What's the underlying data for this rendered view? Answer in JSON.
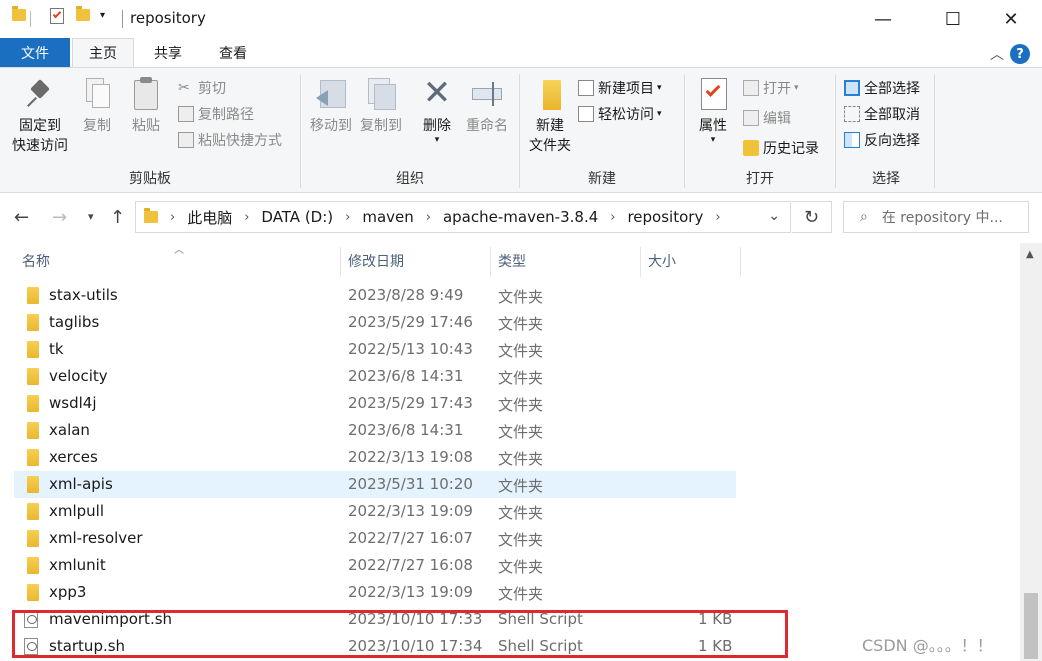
{
  "window": {
    "title": "repository",
    "minimize": "—",
    "maximize": "☐",
    "close": "✕"
  },
  "ribbon_tabs": {
    "file": "文件",
    "home": "主页",
    "share": "共享",
    "view": "查看"
  },
  "ribbon": {
    "clipboard": {
      "label": "剪贴板",
      "pin": [
        "固定到",
        "快速访问"
      ],
      "copy": "复制",
      "paste": "粘贴",
      "cut": "剪切",
      "copy_path": "复制路径",
      "paste_shortcut": "粘贴快捷方式"
    },
    "organize": {
      "label": "组织",
      "move_to": "移动到",
      "copy_to": "复制到",
      "delete": "删除",
      "rename": "重命名"
    },
    "new": {
      "label": "新建",
      "new_folder": [
        "新建",
        "文件夹"
      ],
      "new_item": "新建项目",
      "easy_access": "轻松访问"
    },
    "open": {
      "label": "打开",
      "properties": "属性",
      "open": "打开",
      "edit": "编辑",
      "history": "历史记录"
    },
    "select": {
      "label": "选择",
      "select_all": "全部选择",
      "select_none": "全部取消",
      "invert": "反向选择"
    }
  },
  "address": {
    "crumbs": [
      "此电脑",
      "DATA (D:)",
      "maven",
      "apache-maven-3.8.4",
      "repository"
    ],
    "search_placeholder": "在 repository 中..."
  },
  "columns": {
    "name": "名称",
    "modified": "修改日期",
    "type": "类型",
    "size": "大小"
  },
  "files": [
    {
      "name": "stax-utils",
      "date": "2023/8/28 9:49",
      "type": "文件夹",
      "size": "",
      "kind": "folder"
    },
    {
      "name": "taglibs",
      "date": "2023/5/29 17:46",
      "type": "文件夹",
      "size": "",
      "kind": "folder"
    },
    {
      "name": "tk",
      "date": "2022/5/13 10:43",
      "type": "文件夹",
      "size": "",
      "kind": "folder"
    },
    {
      "name": "velocity",
      "date": "2023/6/8 14:31",
      "type": "文件夹",
      "size": "",
      "kind": "folder"
    },
    {
      "name": "wsdl4j",
      "date": "2023/5/29 17:43",
      "type": "文件夹",
      "size": "",
      "kind": "folder"
    },
    {
      "name": "xalan",
      "date": "2023/6/8 14:31",
      "type": "文件夹",
      "size": "",
      "kind": "folder"
    },
    {
      "name": "xerces",
      "date": "2022/3/13 19:08",
      "type": "文件夹",
      "size": "",
      "kind": "folder"
    },
    {
      "name": "xml-apis",
      "date": "2023/5/31 10:20",
      "type": "文件夹",
      "size": "",
      "kind": "folder",
      "selected": true
    },
    {
      "name": "xmlpull",
      "date": "2022/3/13 19:09",
      "type": "文件夹",
      "size": "",
      "kind": "folder"
    },
    {
      "name": "xml-resolver",
      "date": "2022/7/27 16:07",
      "type": "文件夹",
      "size": "",
      "kind": "folder"
    },
    {
      "name": "xmlunit",
      "date": "2022/7/27 16:08",
      "type": "文件夹",
      "size": "",
      "kind": "folder"
    },
    {
      "name": "xpp3",
      "date": "2022/3/13 19:09",
      "type": "文件夹",
      "size": "",
      "kind": "folder"
    },
    {
      "name": "mavenimport.sh",
      "date": "2023/10/10 17:33",
      "type": "Shell Script",
      "size": "1 KB",
      "kind": "script"
    },
    {
      "name": "startup.sh",
      "date": "2023/10/10 17:34",
      "type": "Shell Script",
      "size": "1 KB",
      "kind": "script"
    }
  ],
  "watermark": "CSDN @。。。！！",
  "colors": {
    "accent": "#1a6fc1",
    "selection": "#e5f3ff",
    "highlight_box": "#e0282e",
    "folder": "#f0c23b"
  }
}
